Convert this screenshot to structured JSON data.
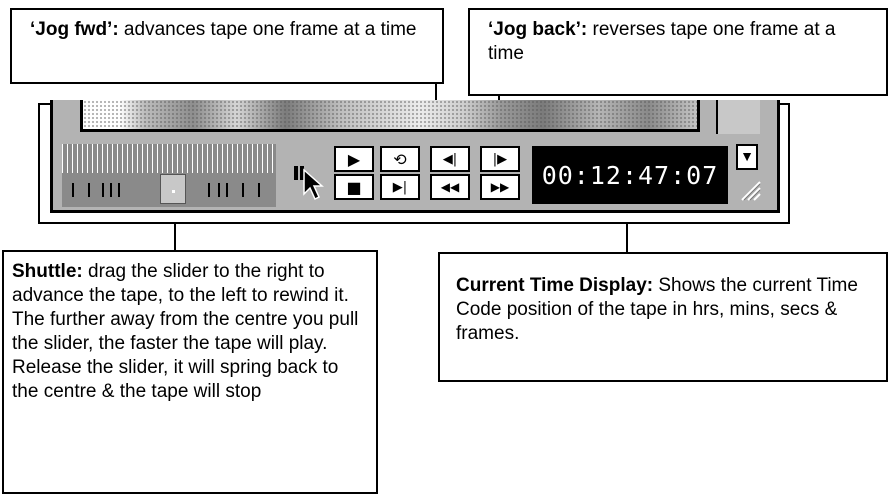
{
  "callouts": {
    "jog_fwd": {
      "title": "‘Jog fwd’:",
      "text": " advances tape one frame at a time"
    },
    "jog_back": {
      "title": "‘Jog back’:",
      "text": " reverses tape one frame at a time"
    },
    "shuttle": {
      "title": "Shuttle:",
      "text": " drag the slider to the right to advance the tape, to the left to rewind it. The further away from the centre you pull the slider, the faster the tape will play. Release the slider, it will spring back to the centre & the tape will stop"
    },
    "current_time": {
      "title": "Current Time Display:",
      "text": " Shows the current Time Code position of the tape in hrs, mins, secs & frames."
    }
  },
  "controls": {
    "timecode": "00:12:47:07",
    "play_icon": "▶",
    "stop_icon": "■",
    "loop_icon": "⟲",
    "step_icon": "▶|",
    "jog_back_icon": "◀|",
    "jog_fwd_icon": "|▶",
    "rewind_icon": "◀◀",
    "fast_forward_icon": "▶▶",
    "menu_icon": "▼"
  }
}
